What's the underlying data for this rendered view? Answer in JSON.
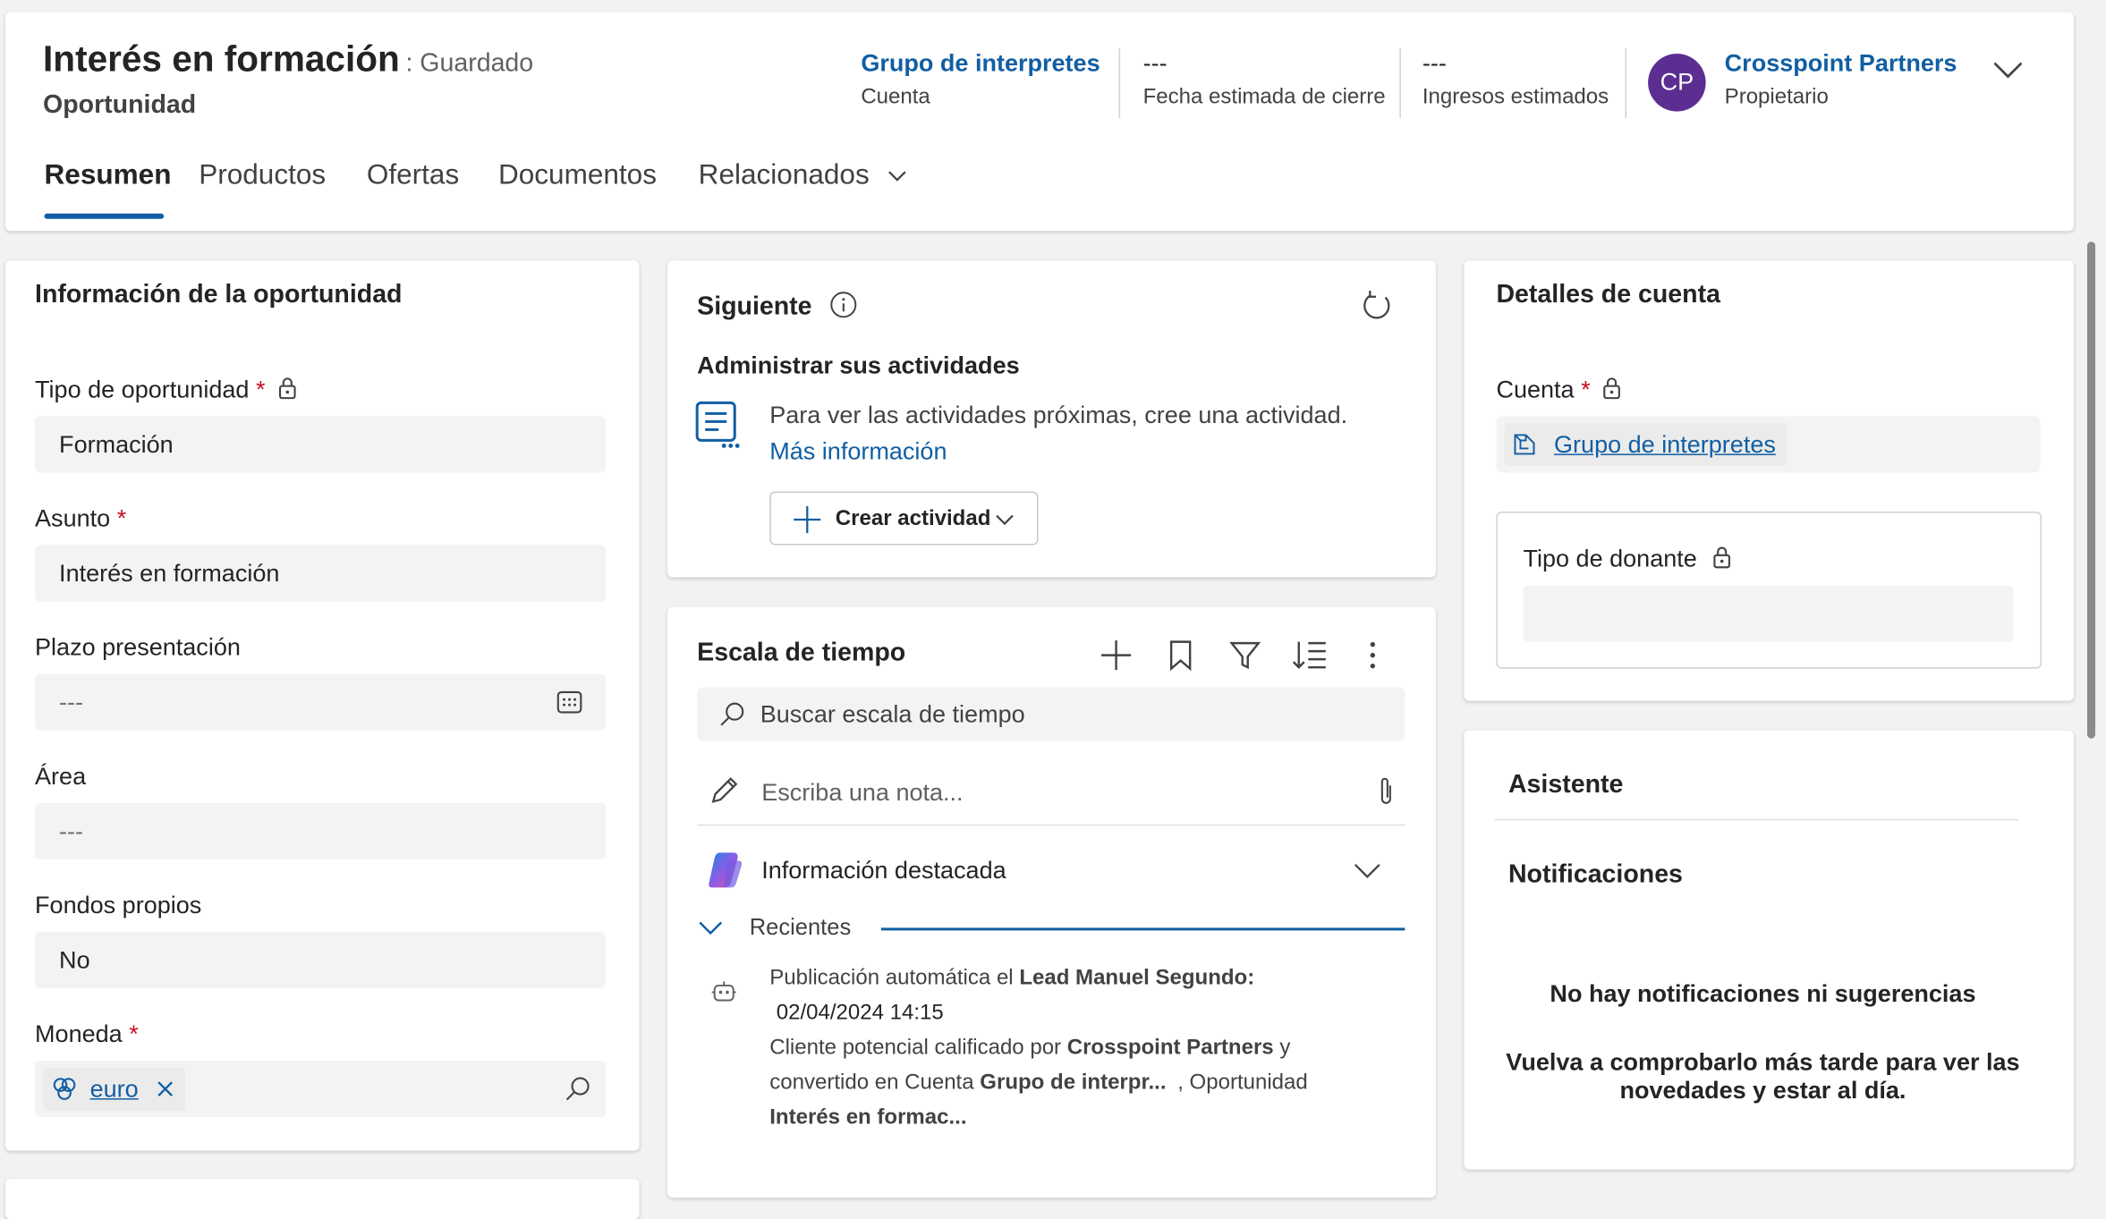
{
  "header": {
    "title": "Interés en formación",
    "save_status": ": Guardado",
    "entity": "Oportunidad",
    "account_value": "Grupo de interpretes",
    "account_label": "Cuenta",
    "close_date_value": "---",
    "close_date_label": "Fecha estimada de cierre",
    "revenue_value": "---",
    "revenue_label": "Ingresos estimados",
    "owner_initials": "CP",
    "owner_name": "Crosspoint Partners",
    "owner_label": "Propietario"
  },
  "tabs": [
    {
      "label": "Resumen"
    },
    {
      "label": "Productos"
    },
    {
      "label": "Ofertas"
    },
    {
      "label": "Documentos"
    },
    {
      "label": "Relacionados"
    }
  ],
  "info": {
    "title": "Información de la oportunidad",
    "tipo_label": "Tipo de oportunidad",
    "tipo_value": "Formación",
    "asunto_label": "Asunto",
    "asunto_value": "Interés en formación",
    "plazo_label": "Plazo presentación",
    "plazo_value": "---",
    "area_label": "Área",
    "area_value": "---",
    "fondos_label": "Fondos propios",
    "fondos_value": "No",
    "moneda_label": "Moneda",
    "moneda_value": "euro",
    "required_mark": "*"
  },
  "next": {
    "title": "Siguiente",
    "subtitle": "Administrar sus actividades",
    "message": "Para ver las actividades próximas, cree una actividad.",
    "learn_more": "Más información",
    "create_button": "Crear actividad"
  },
  "timeline": {
    "title": "Escala de tiempo",
    "search_placeholder": "Buscar escala de tiempo",
    "note_placeholder": "Escriba una nota...",
    "highlights": "Información destacada",
    "recent": "Recientes",
    "post": {
      "prefix": "Publicación automática el",
      "lead": "Lead Manuel Segundo:",
      "timestamp": "02/04/2024 14:15",
      "line1_a": "Cliente potencial calificado por",
      "line1_b": "Crosspoint Partners",
      "line1_c": "y",
      "line2_a": "convertido en Cuenta",
      "line2_b": "Grupo de interpr...",
      "line2_c": ", Oportunidad",
      "line3": "Interés en formac..."
    }
  },
  "account_details": {
    "title": "Detalles de cuenta",
    "cuenta_label": "Cuenta",
    "cuenta_value": "Grupo de interpretes",
    "donante_label": "Tipo de donante",
    "donante_value": ""
  },
  "assistant": {
    "title": "Asistente",
    "notifications": "Notificaciones",
    "empty_title": "No hay notificaciones ni sugerencias",
    "empty_body": "Vuelva a comprobarlo más tarde para ver las novedades y estar al día."
  },
  "colors": {
    "accent": "#115ea3",
    "avatar": "#5c2e91",
    "required": "#c50f1f"
  }
}
